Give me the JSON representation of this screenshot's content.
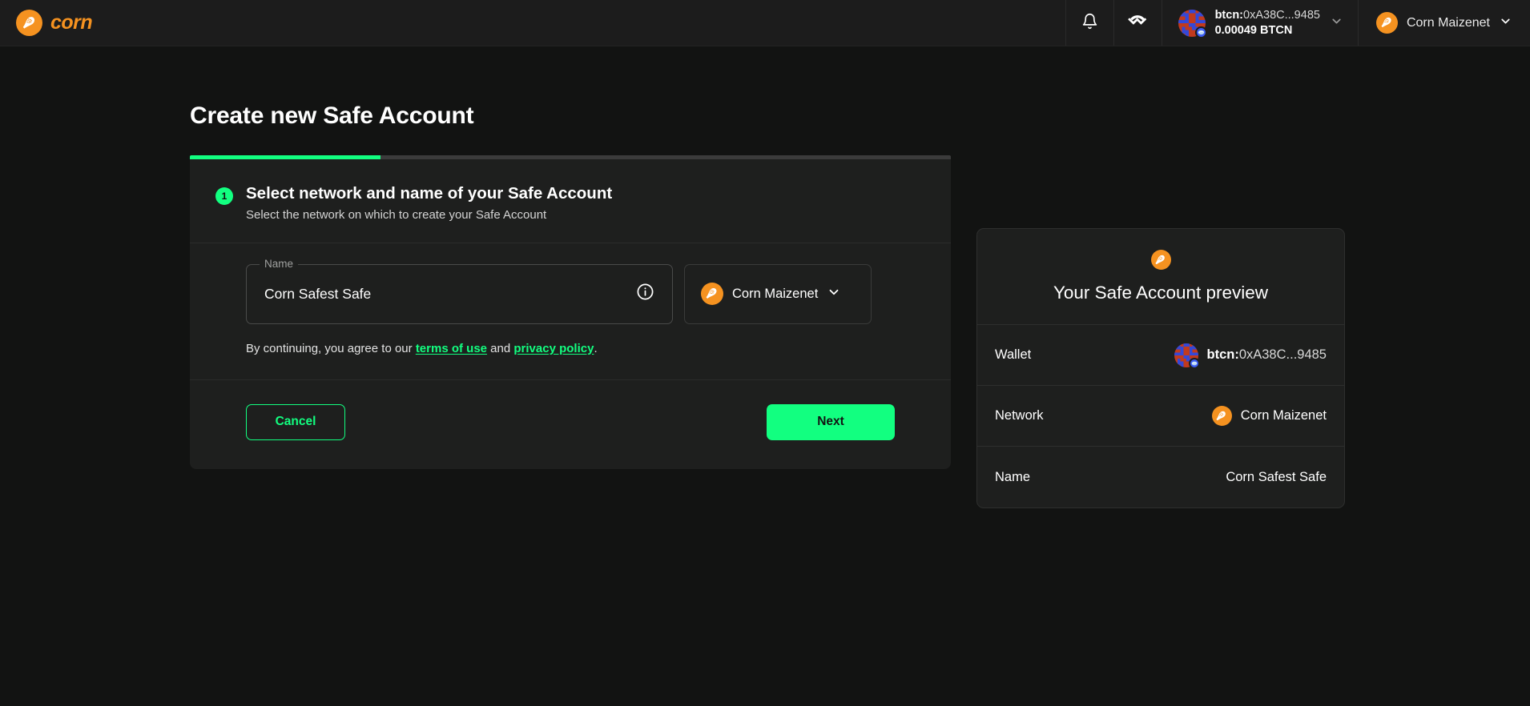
{
  "colors": {
    "accent_green": "#12FF80",
    "brand_orange": "#F59220",
    "page_bg": "#121312",
    "card_bg": "#1e1f1e",
    "header_bg": "#1c1c1c"
  },
  "header": {
    "brand_name": "corn",
    "brand_icon": "corn-cob-icon",
    "notifications_icon": "bell-icon",
    "walletconnect_icon": "walletconnect-icon",
    "wallet": {
      "prefix": "btcn:",
      "address": "0xA38C...9485",
      "balance": "0.00049 BTCN",
      "identicon": "blockie-identicon",
      "provider_badge_icon": "rabby-wallet-badge-icon",
      "chevron_icon": "chevron-down-icon"
    },
    "network": {
      "label": "Corn Maizenet",
      "icon": "corn-cob-icon",
      "chevron_icon": "chevron-down-icon"
    }
  },
  "main": {
    "page_title": "Create new Safe Account",
    "progress_percent": 25,
    "step": {
      "number": "1",
      "title": "Select network and name of your Safe Account",
      "subtitle": "Select the network on which to create your Safe Account"
    },
    "name_field": {
      "legend": "Name",
      "value": "Corn Safest Safe",
      "placeholder": "Name",
      "info_icon": "info-circle-icon"
    },
    "network_select": {
      "label": "Corn Maizenet",
      "icon": "corn-cob-icon",
      "chevron_icon": "chevron-down-icon"
    },
    "terms": {
      "prefix": "By continuing, you agree to our ",
      "link_terms": "terms of use",
      "middle": " and ",
      "link_privacy": "privacy policy",
      "suffix": "."
    },
    "actions": {
      "cancel_label": "Cancel",
      "next_label": "Next"
    }
  },
  "preview": {
    "icon": "corn-cob-icon",
    "title": "Your Safe Account preview",
    "rows": [
      {
        "key": "Wallet",
        "value_prefix": "btcn:",
        "value": "0xA38C...9485",
        "icon": "blockie-identicon"
      },
      {
        "key": "Network",
        "value": "Corn Maizenet",
        "icon": "corn-cob-icon"
      },
      {
        "key": "Name",
        "value": "Corn Safest Safe",
        "icon": ""
      }
    ]
  }
}
